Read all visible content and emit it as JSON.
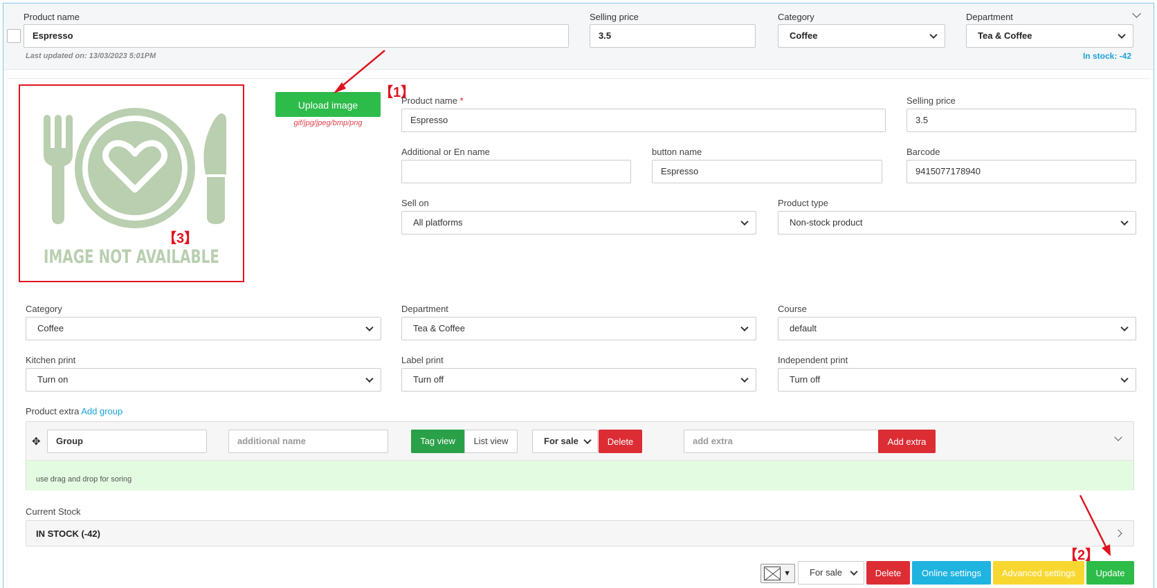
{
  "header": {
    "product_name_label": "Product name",
    "product_name_value": "Espresso",
    "selling_price_label": "Selling price",
    "selling_price_value": "3.5",
    "category_label": "Category",
    "category_value": "Coffee",
    "department_label": "Department",
    "department_value": "Tea & Coffee",
    "last_updated": "Last updated on: 13/03/2023 5:01PM",
    "in_stock": "In stock: -42"
  },
  "image": {
    "placeholder_text": "IMAGE NOT AVAILABLE",
    "upload_label": "Upload image",
    "formats": "gif/jpg/jpeg/bmp/png"
  },
  "annotations": {
    "a1": "【1】",
    "a2": "【2】",
    "a3": "【3】"
  },
  "form": {
    "product_name_label": "Product name",
    "product_name_required": "*",
    "product_name_value": "Espresso",
    "selling_price_label": "Selling price",
    "selling_price_value": "3.5",
    "additional_name_label": "Additional or En name",
    "additional_name_value": "",
    "button_name_label": "button name",
    "button_name_value": "Espresso",
    "barcode_label": "Barcode",
    "barcode_value": "9415077178940",
    "sell_on_label": "Sell on",
    "sell_on_value": "All platforms",
    "product_type_label": "Product type",
    "product_type_value": "Non-stock product",
    "category_label": "Category",
    "category_value": "Coffee",
    "department_label": "Department",
    "department_value": "Tea & Coffee",
    "course_label": "Course",
    "course_value": "default",
    "kitchen_print_label": "Kitchen print",
    "kitchen_print_value": "Turn on",
    "label_print_label": "Label print",
    "label_print_value": "Turn off",
    "independent_print_label": "Independent print",
    "independent_print_value": "Turn off"
  },
  "extras": {
    "label": "Product extra",
    "add_group": "Add group",
    "group_value": "Group",
    "additional_name_placeholder": "additional name",
    "tag_view": "Tag view",
    "list_view": "List view",
    "status_value": "For sale",
    "delete_label": "Delete",
    "add_extra_placeholder": "add extra",
    "add_extra_label": "Add extra",
    "hint": "use drag and drop for soring"
  },
  "stock": {
    "label": "Current Stock",
    "summary": "IN STOCK (-42)"
  },
  "footer": {
    "status_value": "For sale",
    "delete_label": "Delete",
    "online_settings_label": "Online settings",
    "advanced_settings_label": "Advanced settings",
    "update_label": "Update"
  },
  "colors": {
    "green": "#2dbb4a",
    "red": "#dc2d35",
    "blue": "#1fb3e0",
    "yellow": "#f8d730",
    "annotation_red": "#e0141f",
    "link_blue": "#1aa3d8"
  },
  "icons": {
    "drag": "move-icon",
    "image_placeholder": "fork-plate-knife-icon"
  }
}
